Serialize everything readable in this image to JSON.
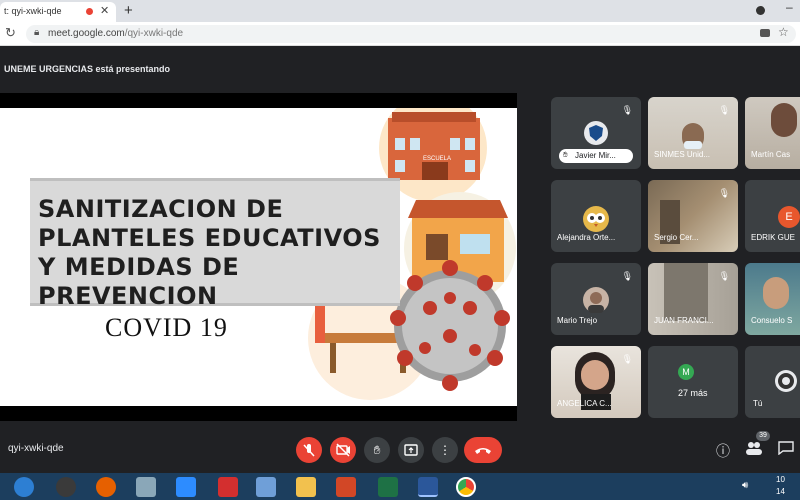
{
  "browser": {
    "tab_title": "t: qyi-xwki-qde",
    "tab_close": "✕",
    "new_tab": "+",
    "url_host": "meet.google.com",
    "url_path": "/qyi-xwki-qde"
  },
  "meet": {
    "presenting_banner": "UNEME URGENCIAS está presentando",
    "meeting_code": "qyi-xwki-qde"
  },
  "slide": {
    "title": "SANITIZACION DE PLANTELES EDUCATIVOS Y MEDIDAS DE PREVENCION",
    "subtitle": "COVID 19",
    "school_sign": "ESCUELA"
  },
  "participants": [
    {
      "name": "Javier Mir...",
      "muted": true,
      "avatar_letter": ""
    },
    {
      "name": "SINMES Unid...",
      "muted": true
    },
    {
      "name": "Martín Cas",
      "muted": false
    },
    {
      "name": "Alejandra Orte...",
      "muted": false
    },
    {
      "name": "Sergio Cer...",
      "muted": true
    },
    {
      "name": "EDRIK GUE",
      "muted": false,
      "avatar_letter": "E"
    },
    {
      "name": "Mario Trejo",
      "muted": true
    },
    {
      "name": "JUAN FRANCI...",
      "muted": true
    },
    {
      "name": "Consuelo S",
      "muted": false
    },
    {
      "name": "ANGELICA C...",
      "muted": true
    },
    {
      "name": "27 más",
      "avatar_letter": "M"
    },
    {
      "name": "Tú"
    }
  ],
  "controls": {
    "people_count": "39"
  },
  "taskbar": {
    "time": "10",
    "date": "14"
  },
  "colors": {
    "meet_bg": "#202124",
    "tile_bg": "#3c4043",
    "red": "#ea4335",
    "taskbar": "#1c3e5e"
  }
}
